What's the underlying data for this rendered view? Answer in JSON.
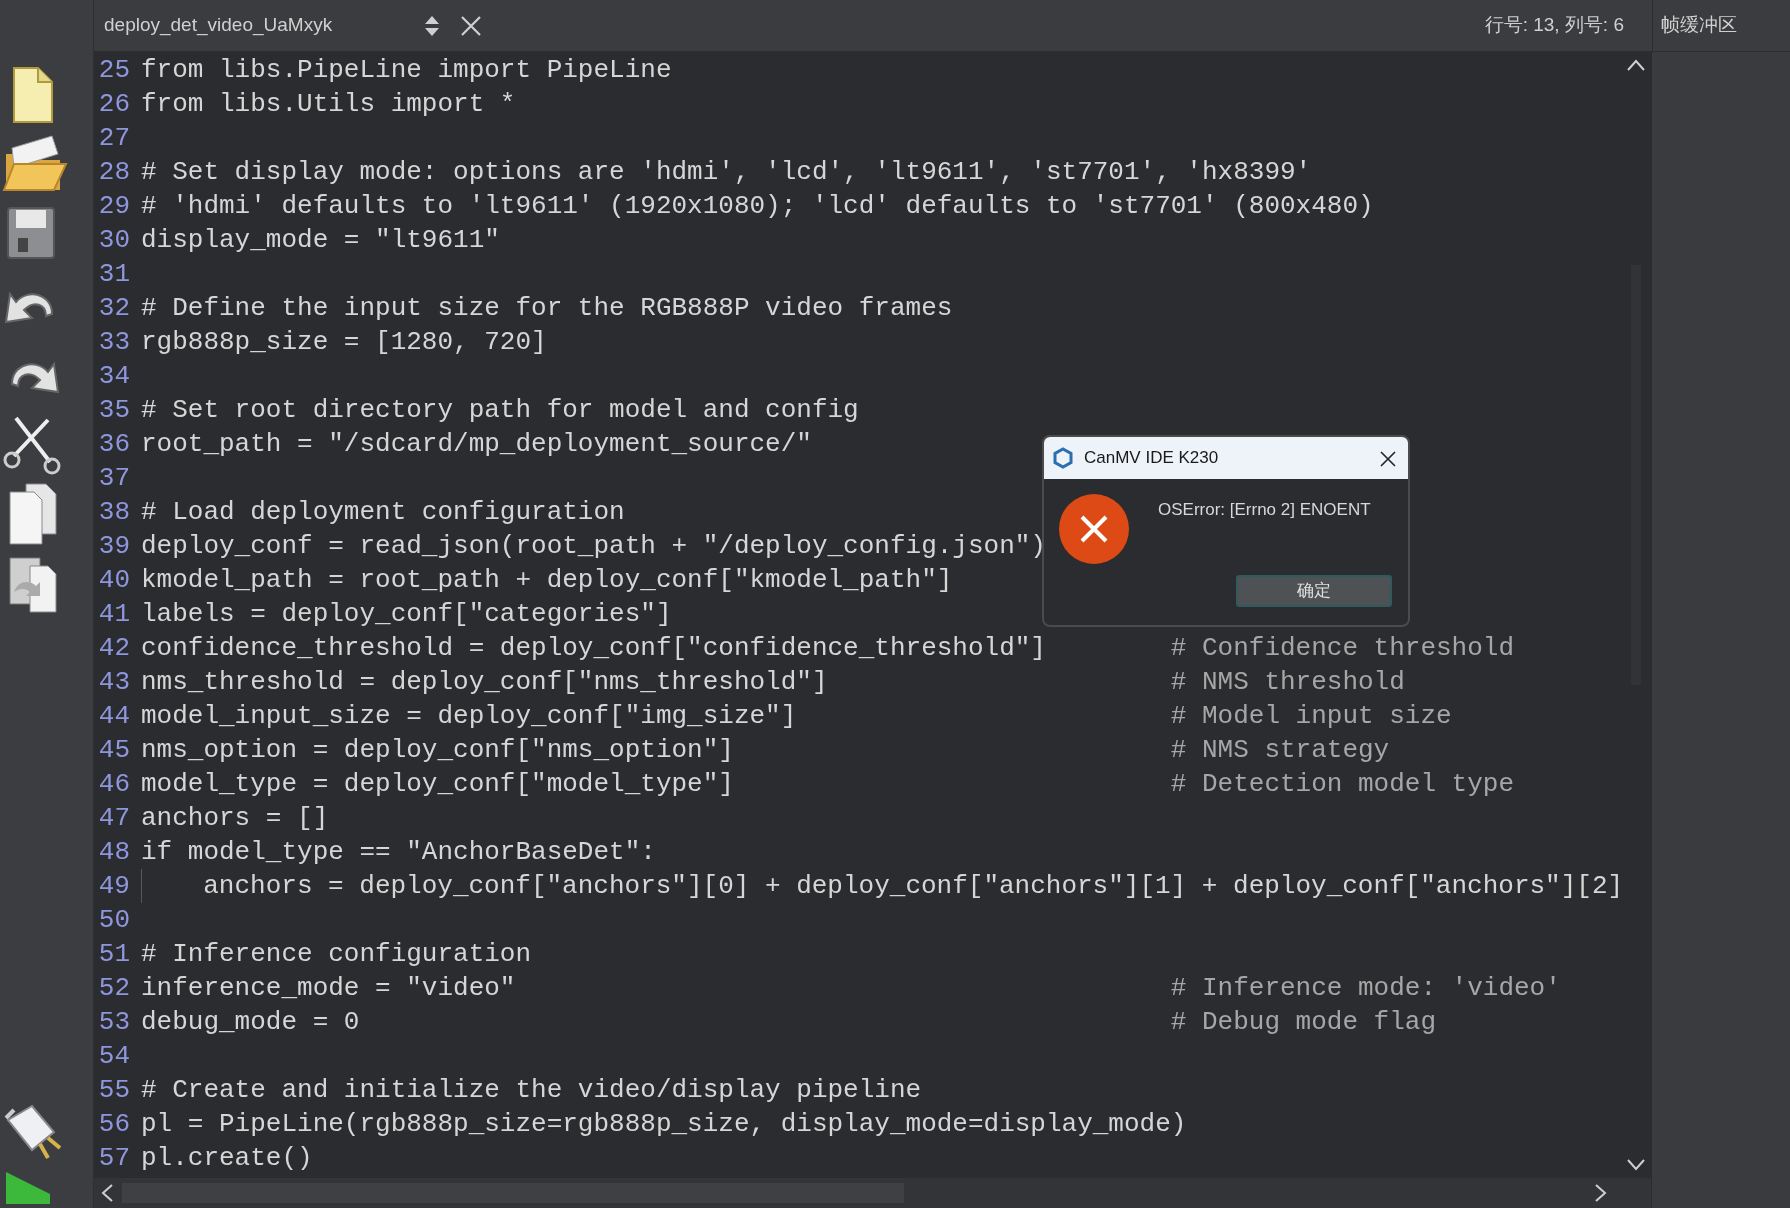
{
  "editor_tab": {
    "file_name": "deploy_det_video_UaMxyk"
  },
  "cursor_position": "行号: 13, 列号: 6",
  "right_panel": {
    "title": "帧缓冲区"
  },
  "lines": [
    {
      "number": "25",
      "code": "from libs.PipeLine import PipeLine"
    },
    {
      "number": "26",
      "code": "from libs.Utils import *"
    },
    {
      "number": "27"
    },
    {
      "number": "28",
      "code": "# Set display mode: options are 'hdmi', 'lcd', 'lt9611', 'st7701', 'hx8399'"
    },
    {
      "number": "29",
      "code": "# 'hdmi' defaults to 'lt9611' (1920x1080); 'lcd' defaults to 'st7701' (800x480)"
    },
    {
      "number": "30",
      "code": "display_mode = \"lt9611\""
    },
    {
      "number": "31"
    },
    {
      "number": "32",
      "code": "# Define the input size for the RGB888P video frames"
    },
    {
      "number": "33",
      "code": "rgb888p_size = [1280, 720]"
    },
    {
      "number": "34"
    },
    {
      "number": "35",
      "code": "# Set root directory path for model and config"
    },
    {
      "number": "36",
      "code": "root_path = \"/sdcard/mp_deployment_source/\""
    },
    {
      "number": "37"
    },
    {
      "number": "38",
      "code": "# Load deployment configuration"
    },
    {
      "number": "39",
      "code": "deploy_conf = read_json(root_path + \"/deploy_config.json\")"
    },
    {
      "number": "40",
      "code": "kmodel_path = root_path + deploy_conf[\"kmodel_path\"]"
    },
    {
      "number": "41",
      "code": "labels = deploy_conf[\"categories\"]"
    },
    {
      "number": "42",
      "code": "confidence_threshold = deploy_conf[\"confidence_threshold\"]",
      "note": "# Confidence threshold"
    },
    {
      "number": "43",
      "code": "nms_threshold = deploy_conf[\"nms_threshold\"]",
      "note": "# NMS threshold"
    },
    {
      "number": "44",
      "code": "model_input_size = deploy_conf[\"img_size\"]",
      "note": "# Model input size"
    },
    {
      "number": "45",
      "code": "nms_option = deploy_conf[\"nms_option\"]",
      "note": "# NMS strategy"
    },
    {
      "number": "46",
      "code": "model_type = deploy_conf[\"model_type\"]",
      "note": "# Detection model type"
    },
    {
      "number": "47",
      "code": "anchors = []"
    },
    {
      "number": "48",
      "code": "if model_type == \"AnchorBaseDet\":"
    },
    {
      "number": "49",
      "code": "    anchors = deploy_conf[\"anchors\"][0] + deploy_conf[\"anchors\"][1] + deploy_conf[\"anchors\"][2]"
    },
    {
      "number": "50"
    },
    {
      "number": "51",
      "code": "# Inference configuration"
    },
    {
      "number": "52",
      "code": "inference_mode = \"video\"",
      "note": "# Inference mode: 'video'"
    },
    {
      "number": "53",
      "code": "debug_mode = 0",
      "note": "# Debug mode flag"
    },
    {
      "number": "54"
    },
    {
      "number": "55",
      "code": "# Create and initialize the video/display pipeline"
    },
    {
      "number": "56",
      "code": "pl = PipeLine(rgb888p_size=rgb888p_size, display_mode=display_mode)"
    },
    {
      "number": "57",
      "code": "pl.create()"
    }
  ],
  "dialog": {
    "title": "CanMV IDE K230",
    "message": "OSError: [Errno 2] ENOENT",
    "buttons": [
      "确定"
    ]
  }
}
